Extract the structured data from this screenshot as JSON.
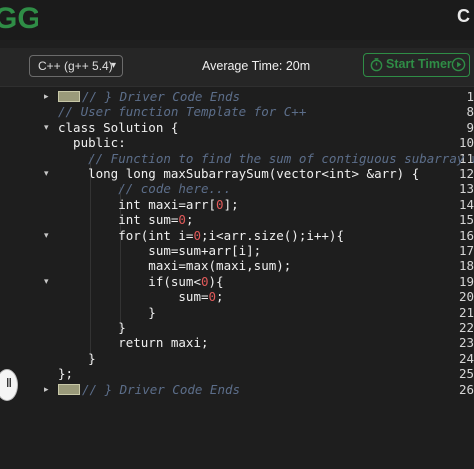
{
  "header": {
    "logo_text": "GG",
    "corner_text": "C"
  },
  "toolbar": {
    "language_selected": "C++ (g++ 5.4)",
    "average_time": "Average Time: 20m",
    "start_timer_label": "Start Timer"
  },
  "editor": {
    "lines": [
      {
        "n": "1",
        "fold": "▸",
        "text": "// } Driver Code Ends",
        "kind": "folded-comment"
      },
      {
        "n": "8",
        "fold": "",
        "text": "// User function Template for C++",
        "kind": "comment"
      },
      {
        "n": "9",
        "fold": "▾",
        "text": "class Solution {",
        "kind": "code"
      },
      {
        "n": "10",
        "fold": "",
        "text": "  public:",
        "kind": "code"
      },
      {
        "n": "11",
        "fold": "",
        "text": "    // Function to find the sum of contiguous subarray w",
        "kind": "comment"
      },
      {
        "n": "12",
        "fold": "▾",
        "text": "    long long maxSubarraySum(vector<int> &arr) {",
        "kind": "code"
      },
      {
        "n": "13",
        "fold": "",
        "text": "        // code here...",
        "kind": "comment"
      },
      {
        "n": "14",
        "fold": "",
        "parts": [
          {
            "t": "        int maxi=arr["
          },
          {
            "t": "0",
            "c": "num"
          },
          {
            "t": "];"
          }
        ],
        "kind": "mixed"
      },
      {
        "n": "15",
        "fold": "",
        "parts": [
          {
            "t": "        int sum="
          },
          {
            "t": "0",
            "c": "num"
          },
          {
            "t": ";"
          }
        ],
        "kind": "mixed"
      },
      {
        "n": "16",
        "fold": "▾",
        "parts": [
          {
            "t": "        for(int i="
          },
          {
            "t": "0",
            "c": "num"
          },
          {
            "t": ";i<arr.size();i++){"
          }
        ],
        "kind": "mixed"
      },
      {
        "n": "17",
        "fold": "",
        "text": "            sum=sum+arr[i];",
        "kind": "code"
      },
      {
        "n": "18",
        "fold": "",
        "text": "            maxi=max(maxi,sum);",
        "kind": "code"
      },
      {
        "n": "19",
        "fold": "▾",
        "parts": [
          {
            "t": "            if(sum<"
          },
          {
            "t": "0",
            "c": "num"
          },
          {
            "t": "){"
          }
        ],
        "kind": "mixed"
      },
      {
        "n": "20",
        "fold": "",
        "parts": [
          {
            "t": "                sum="
          },
          {
            "t": "0",
            "c": "num"
          },
          {
            "t": ";"
          }
        ],
        "kind": "mixed"
      },
      {
        "n": "21",
        "fold": "",
        "text": "            }",
        "kind": "code"
      },
      {
        "n": "22",
        "fold": "",
        "text": "        }",
        "kind": "code"
      },
      {
        "n": "23",
        "fold": "",
        "text": "        return maxi;",
        "kind": "code"
      },
      {
        "n": "24",
        "fold": "",
        "text": "    }",
        "kind": "code"
      },
      {
        "n": "25",
        "fold": "",
        "text": "};",
        "kind": "code"
      },
      {
        "n": "26",
        "fold": "▸",
        "text": "// } Driver Code Ends",
        "kind": "folded-comment"
      }
    ]
  },
  "colors": {
    "brand_green": "#2f8d46",
    "comment": "#5c6e8a",
    "number": "#e15a5a"
  }
}
